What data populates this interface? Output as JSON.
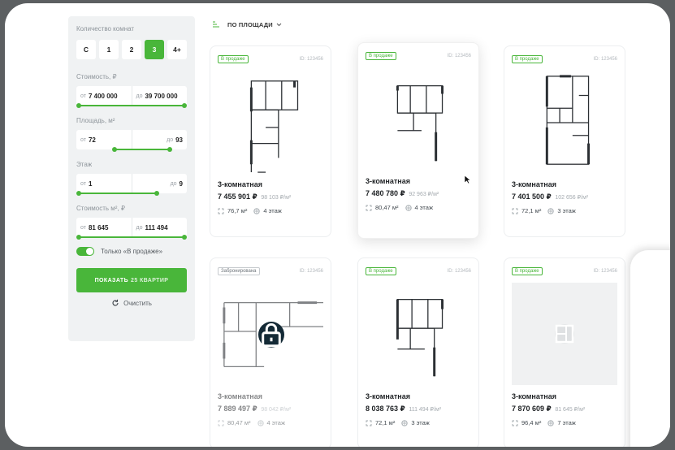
{
  "filters": {
    "rooms_label": "Количество комнат",
    "rooms": [
      "С",
      "1",
      "2",
      "3",
      "4+"
    ],
    "rooms_active": "3",
    "price_label": "Стоимость, ₽",
    "price_from_prefix": "от",
    "price_from": "7 400 000",
    "price_to_prefix": "до",
    "price_to": "39 700 000",
    "area_label": "Площадь, м²",
    "area_from_prefix": "от",
    "area_from": "72",
    "area_to_prefix": "до",
    "area_to": "93",
    "floor_label": "Этаж",
    "floor_from_prefix": "от",
    "floor_from": "1",
    "floor_to_prefix": "до",
    "floor_to": "9",
    "ppm_label": "Стоимость м², ₽",
    "ppm_from_prefix": "от",
    "ppm_from": "81 645",
    "ppm_to_prefix": "до",
    "ppm_to": "111 494",
    "only_on_sale_label": "Только «В продаже»",
    "only_on_sale_on": true,
    "show_button_label": "ПОКАЗАТЬ",
    "show_button_count": "25 КВАРТИР",
    "clear_label": "Очистить"
  },
  "sort": {
    "label": "ПО ПЛОЩАДИ"
  },
  "cards": [
    {
      "status": "В продаже",
      "id": "ID: 123456",
      "title": "3-комнатная",
      "price": "7 455 901 ₽",
      "price_per_m2": "98 103 ₽/м²",
      "area": "76,7 м²",
      "floor": "4 этаж"
    },
    {
      "status": "В продаже",
      "id": "ID: 123456",
      "title": "3-комнатная",
      "price": "7 480 780 ₽",
      "price_per_m2": "92 963 ₽/м²",
      "area": "80,47 м²",
      "floor": "4 этаж"
    },
    {
      "status": "В продаже",
      "id": "ID: 123456",
      "title": "3-комнатная",
      "price": "7 401 500 ₽",
      "price_per_m2": "102 656 ₽/м²",
      "area": "72,1 м²",
      "floor": "3 этаж"
    },
    {
      "status": "Забронирована",
      "id": "ID: 123456",
      "title": "3-комнатная",
      "price": "7 889 497 ₽",
      "price_per_m2": "98 042 ₽/м²",
      "area": "80,47 м²",
      "floor": "4 этаж"
    },
    {
      "status": "В продаже",
      "id": "ID: 123456",
      "title": "3-комнатная",
      "price": "8 038 763 ₽",
      "price_per_m2": "111 494 ₽/м²",
      "area": "72,1 м²",
      "floor": "3 этаж"
    },
    {
      "status": "В продаже",
      "id": "ID: 123456",
      "title": "3-комнатная",
      "price": "7 870 609 ₽",
      "price_per_m2": "81 645 ₽/м²",
      "area": "96,4 м²",
      "floor": "7 этаж"
    }
  ],
  "colors": {
    "accent": "#49b63a",
    "panel_bg": "#f0f2f3",
    "lock_bg": "#142a36"
  }
}
